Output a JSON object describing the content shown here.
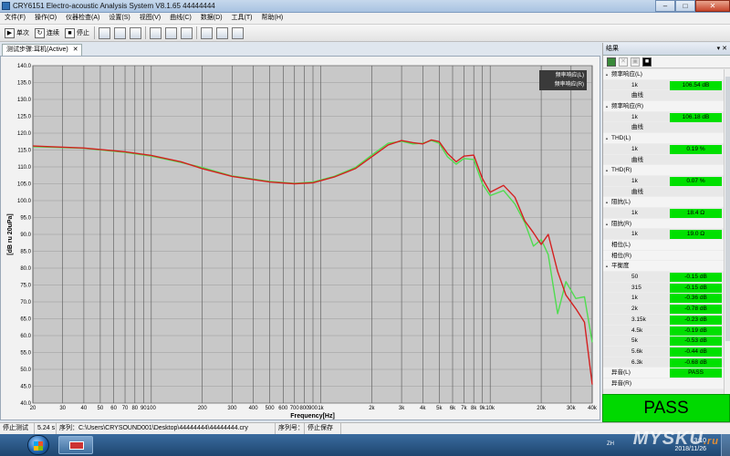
{
  "window": {
    "title": "CRY6151 Electro-acoustic Analysis System  V8.1.65 44444444",
    "min": "–",
    "max": "□",
    "close": "✕"
  },
  "menus": [
    "文件(F)",
    "操作(O)",
    "仪器检查(A)",
    "设置(S)",
    "视图(V)",
    "曲线(C)",
    "数据(D)",
    "工具(T)",
    "帮助(H)"
  ],
  "toolbar": {
    "single": "单次",
    "continuous": "连续",
    "stop": "停止"
  },
  "tab": {
    "label": "测试步骤:耳机(Active)",
    "close": "✕"
  },
  "legend": [
    "频率响应(L)",
    "频率响应(R)"
  ],
  "side": {
    "title": "结果",
    "pin": "▾ ✕",
    "tools": [
      "✕",
      "▣",
      "■"
    ],
    "rows": [
      {
        "type": "group",
        "label": "频率响应(L)"
      },
      {
        "type": "item",
        "key": "1k",
        "value": "106.54  dB"
      },
      {
        "type": "item",
        "key": "曲线",
        "value": ""
      },
      {
        "type": "group",
        "label": "频率响应(R)"
      },
      {
        "type": "item",
        "key": "1k",
        "value": "106.18  dB"
      },
      {
        "type": "item",
        "key": "曲线",
        "value": ""
      },
      {
        "type": "group",
        "label": "THD(L)"
      },
      {
        "type": "item",
        "key": "1k",
        "value": "0.19  %"
      },
      {
        "type": "item",
        "key": "曲线",
        "value": ""
      },
      {
        "type": "group",
        "label": "THD(R)"
      },
      {
        "type": "item",
        "key": "1k",
        "value": "0.07  %"
      },
      {
        "type": "item",
        "key": "曲线",
        "value": ""
      },
      {
        "type": "group",
        "label": "阻抗(L)"
      },
      {
        "type": "item",
        "key": "1k",
        "value": "18.4  Ω"
      },
      {
        "type": "group",
        "label": "阻抗(R)"
      },
      {
        "type": "item",
        "key": "1k",
        "value": "19.0  Ω"
      },
      {
        "type": "plain",
        "label": "相位(L)"
      },
      {
        "type": "plain",
        "label": "相位(R)"
      },
      {
        "type": "group",
        "label": "平衡度"
      },
      {
        "type": "item",
        "key": "50",
        "value": "-0.15  dB"
      },
      {
        "type": "item",
        "key": "315",
        "value": "-0.15  dB"
      },
      {
        "type": "item",
        "key": "1k",
        "value": "-0.36  dB"
      },
      {
        "type": "item",
        "key": "2k",
        "value": "-0.78  dB"
      },
      {
        "type": "item",
        "key": "3.15k",
        "value": "-0.23  dB"
      },
      {
        "type": "item",
        "key": "4.5k",
        "value": "-0.19  dB"
      },
      {
        "type": "item",
        "key": "5k",
        "value": "-0.53  dB"
      },
      {
        "type": "item",
        "key": "5.6k",
        "value": "-0.44  dB"
      },
      {
        "type": "item",
        "key": "6.3k",
        "value": "-0.68  dB"
      },
      {
        "type": "plain",
        "label": "异音(L)",
        "value": "PASS"
      },
      {
        "type": "plain",
        "label": "异音(R)",
        "value": ""
      }
    ]
  },
  "pass_label": "PASS",
  "status": {
    "mode": "停止测试",
    "time": "5.24  s",
    "path": "序列：C:\\Users\\CRYSOUND001\\Desktop\\44444444\\44444444.cry",
    "serial_label": "序列号：",
    "state": "停止保存"
  },
  "taskbar": {
    "lang": "ZH",
    "time": "3:10",
    "date": "2018/11/26"
  },
  "watermark": {
    "main": "MYSKU",
    "suffix": ".ru"
  },
  "colors": {
    "left": "#e02020",
    "right": "#40e040",
    "pass": "#00d900",
    "plot_bg": "#c8c8c8"
  },
  "chart_data": {
    "type": "line",
    "xlabel": "Frequency[Hz]",
    "ylabel": "[dB ru 20uPa]",
    "xscale": "log",
    "xlim": [
      20,
      40000
    ],
    "ylim": [
      40,
      140
    ],
    "yticks": [
      "140.0",
      "135.0",
      "130.0",
      "125.0",
      "120.0",
      "115.0",
      "110.0",
      "105.0",
      "100.0",
      "95.0",
      "90.0",
      "85.0",
      "80.0",
      "75.0",
      "70.0",
      "65.0",
      "60.0",
      "55.0",
      "50.0",
      "45.0",
      "40.0"
    ],
    "xticks": [
      {
        "v": 20,
        "t": "20"
      },
      {
        "v": 30,
        "t": "30"
      },
      {
        "v": 40,
        "t": "40"
      },
      {
        "v": 50,
        "t": "50"
      },
      {
        "v": 60,
        "t": "60"
      },
      {
        "v": 70,
        "t": "70"
      },
      {
        "v": 80,
        "t": "80"
      },
      {
        "v": 90,
        "t": "90"
      },
      {
        "v": 100,
        "t": "100"
      },
      {
        "v": 200,
        "t": "200"
      },
      {
        "v": 300,
        "t": "300"
      },
      {
        "v": 400,
        "t": "400"
      },
      {
        "v": 500,
        "t": "500"
      },
      {
        "v": 600,
        "t": "600"
      },
      {
        "v": 700,
        "t": "700"
      },
      {
        "v": 800,
        "t": "800"
      },
      {
        "v": 900,
        "t": "900"
      },
      {
        "v": 1000,
        "t": "1k"
      },
      {
        "v": 2000,
        "t": "2k"
      },
      {
        "v": 3000,
        "t": "3k"
      },
      {
        "v": 4000,
        "t": "4k"
      },
      {
        "v": 5000,
        "t": "5k"
      },
      {
        "v": 6000,
        "t": "6k"
      },
      {
        "v": 7000,
        "t": "7k"
      },
      {
        "v": 8000,
        "t": "8k"
      },
      {
        "v": 9000,
        "t": "9k"
      },
      {
        "v": 10000,
        "t": "10k"
      },
      {
        "v": 20000,
        "t": "20k"
      },
      {
        "v": 30000,
        "t": "30k"
      },
      {
        "v": 40000,
        "t": "40k"
      }
    ],
    "series": [
      {
        "name": "频率响应(L)",
        "color": "#d42020",
        "x": [
          20,
          40,
          70,
          100,
          150,
          200,
          300,
          500,
          700,
          900,
          1200,
          1600,
          2000,
          2500,
          3000,
          3500,
          4000,
          4500,
          5000,
          5600,
          6300,
          7000,
          8000,
          9000,
          10000,
          12000,
          14000,
          16000,
          18000,
          20000,
          22000,
          25000,
          28000,
          32000,
          36000,
          40000
        ],
        "y": [
          116.2,
          115.6,
          114.5,
          113.4,
          111.5,
          109.5,
          107.2,
          105.5,
          105.0,
          105.3,
          107.0,
          109.5,
          113.0,
          116.5,
          117.8,
          117.2,
          116.8,
          118.0,
          117.5,
          114.0,
          111.5,
          113.2,
          113.5,
          106.5,
          102.5,
          104.5,
          101.0,
          94.0,
          90.5,
          87.0,
          90.0,
          79.0,
          72.0,
          68.0,
          64.0,
          45.5
        ]
      },
      {
        "name": "频率响应(R)",
        "color": "#4fdc4f",
        "x": [
          20,
          40,
          70,
          100,
          150,
          200,
          300,
          500,
          700,
          900,
          1200,
          1600,
          2000,
          2500,
          3000,
          3500,
          4000,
          4500,
          5000,
          5600,
          6300,
          7000,
          8000,
          9000,
          10000,
          12000,
          14000,
          16000,
          18000,
          20000,
          22000,
          25000,
          28000,
          32000,
          36000,
          40000
        ],
        "y": [
          116.0,
          115.5,
          114.3,
          113.2,
          111.3,
          109.8,
          107.3,
          105.7,
          105.1,
          105.5,
          107.2,
          109.8,
          113.5,
          117.0,
          117.6,
          116.8,
          117.0,
          117.8,
          117.0,
          113.0,
          110.8,
          112.5,
          112.2,
          105.0,
          101.5,
          103.0,
          99.0,
          93.5,
          86.5,
          88.5,
          84.0,
          66.5,
          76.0,
          71.0,
          71.5,
          58.0
        ]
      }
    ]
  }
}
